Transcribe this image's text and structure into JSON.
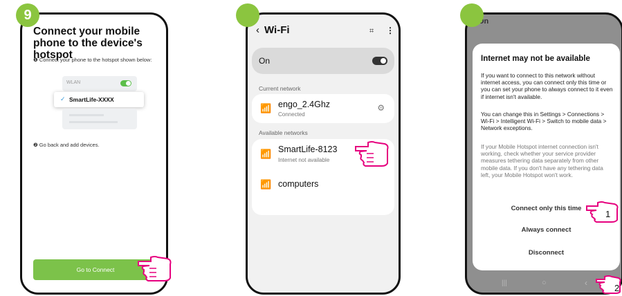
{
  "colors": {
    "accent_green": "#8bc53f",
    "button_green": "#7cc24a",
    "toggle_green": "#5cbf4a",
    "hand_pink": "#e6007e"
  },
  "step1": {
    "badge": "9",
    "title": "Connect your mobile phone to the device's hotspot",
    "instruction1": "❶ Connect your phone to the hotspot shown below:",
    "wlan_label": "WLAN",
    "selected_network": "SmartLife-XXXX",
    "instruction2": "❷ Go back and add devices.",
    "connect_button": "Go to Connect"
  },
  "step2": {
    "header_title": "Wi-Fi",
    "toggle_label": "On",
    "current_section": "Current network",
    "current_network": {
      "name": "engo_2.4Ghz",
      "status": "Connected"
    },
    "available_section": "Available networks",
    "networks": [
      {
        "name": "SmartLife-8123",
        "status": "Internet not available"
      },
      {
        "name": "computers",
        "status": ""
      }
    ]
  },
  "step3": {
    "status_text": "On",
    "dialog_title": "Internet may not be available",
    "paragraph1": "If you want to connect to this network without internet access, you can connect only this time or you can set your phone to always connect to it even if internet isn't available.",
    "paragraph2": "You can change this in Settings > Connections > Wi-Fi > Intelligent Wi-Fi > Switch to mobile data > Network exceptions.",
    "paragraph3": "If your Mobile Hotspot internet connection isn't working, check whether your service provider measures tethering data separately from other mobile data. If you don't have any tethering data left, your Mobile Hotspot won't work.",
    "options": [
      "Connect only this time",
      "Always connect",
      "Disconnect"
    ],
    "marker1": "1",
    "marker2": "2"
  }
}
